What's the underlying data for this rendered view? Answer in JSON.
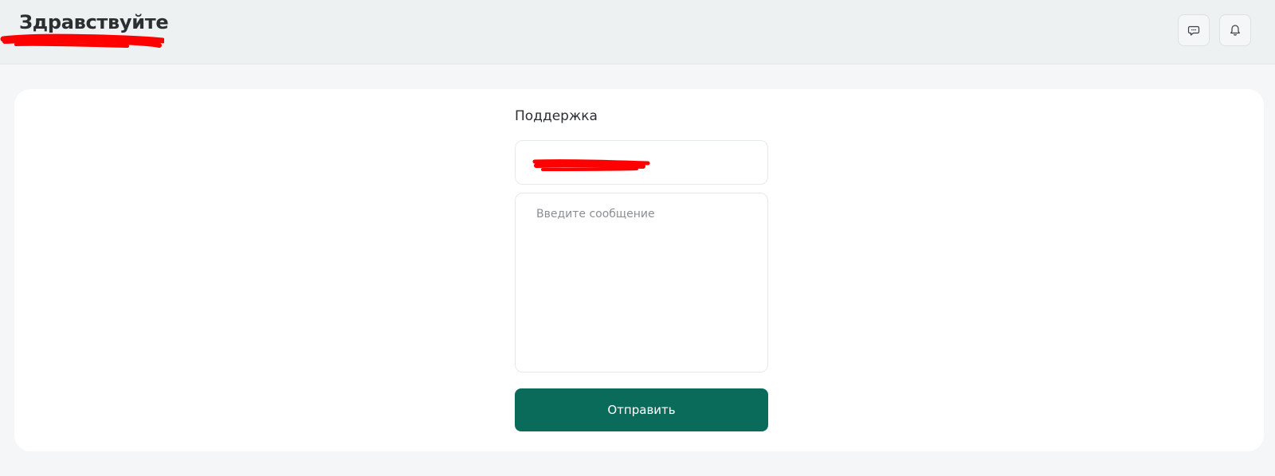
{
  "header": {
    "greeting": "Здравствуйте",
    "icons": {
      "chat": "chat-bubble-icon",
      "bell": "bell-icon"
    }
  },
  "support_form": {
    "title": "Поддержка",
    "message_placeholder": "Введите сообщение",
    "send_label": "Отправить"
  },
  "colors": {
    "accent": "#0a6b5a",
    "redaction": "#ff0000",
    "page_background": "#f4f6f7",
    "header_background": "#eef1f2"
  }
}
